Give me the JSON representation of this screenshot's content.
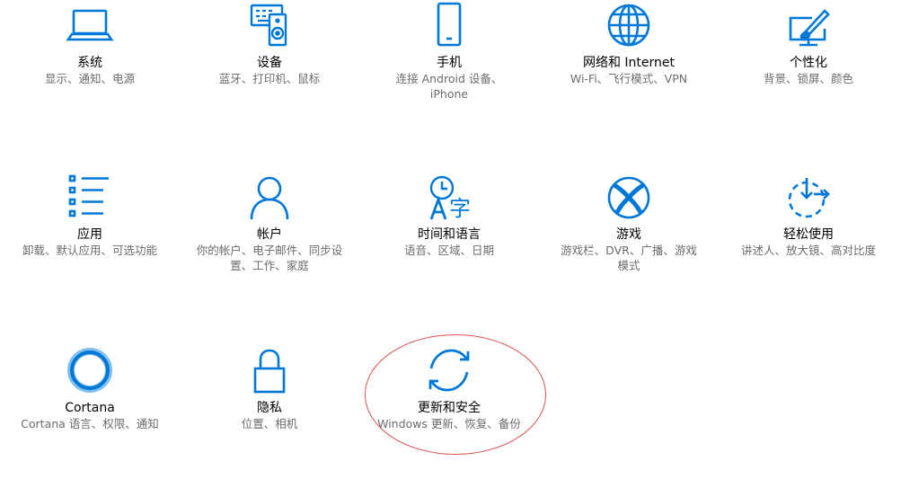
{
  "colors": {
    "accent": "#0078d7",
    "title_text": "#000000",
    "desc_text": "#6b6b6b",
    "annotation": "#d9534f"
  },
  "settings": [
    {
      "title": "系统",
      "desc": "显示、通知、电源",
      "icon": "laptop-icon"
    },
    {
      "title": "设备",
      "desc": "蓝牙、打印机、鼠标",
      "icon": "devices-icon"
    },
    {
      "title": "手机",
      "desc": "连接 Android 设备、iPhone",
      "icon": "phone-icon"
    },
    {
      "title": "网络和 Internet",
      "desc": "Wi-Fi、飞行模式、VPN",
      "icon": "globe-icon"
    },
    {
      "title": "个性化",
      "desc": "背景、锁屏、颜色",
      "icon": "paint-brush-icon"
    },
    {
      "title": "应用",
      "desc": "卸载、默认应用、可选功能",
      "icon": "apps-list-icon"
    },
    {
      "title": "帐户",
      "desc": "你的帐户、电子邮件、同步设置、工作、家庭",
      "icon": "person-icon"
    },
    {
      "title": "时间和语言",
      "desc": "语音、区域、日期",
      "icon": "time-language-icon"
    },
    {
      "title": "游戏",
      "desc": "游戏栏、DVR、广播、游戏模式",
      "icon": "xbox-icon"
    },
    {
      "title": "轻松使用",
      "desc": "讲述人、放大镜、高对比度",
      "icon": "ease-of-access-icon"
    },
    {
      "title": "Cortana",
      "desc": "Cortana 语言、权限、通知",
      "icon": "cortana-circle-icon"
    },
    {
      "title": "隐私",
      "desc": "位置、相机",
      "icon": "lock-icon"
    },
    {
      "title": "更新和安全",
      "desc": "Windows 更新、恢复、备份",
      "icon": "sync-arrows-icon"
    }
  ]
}
